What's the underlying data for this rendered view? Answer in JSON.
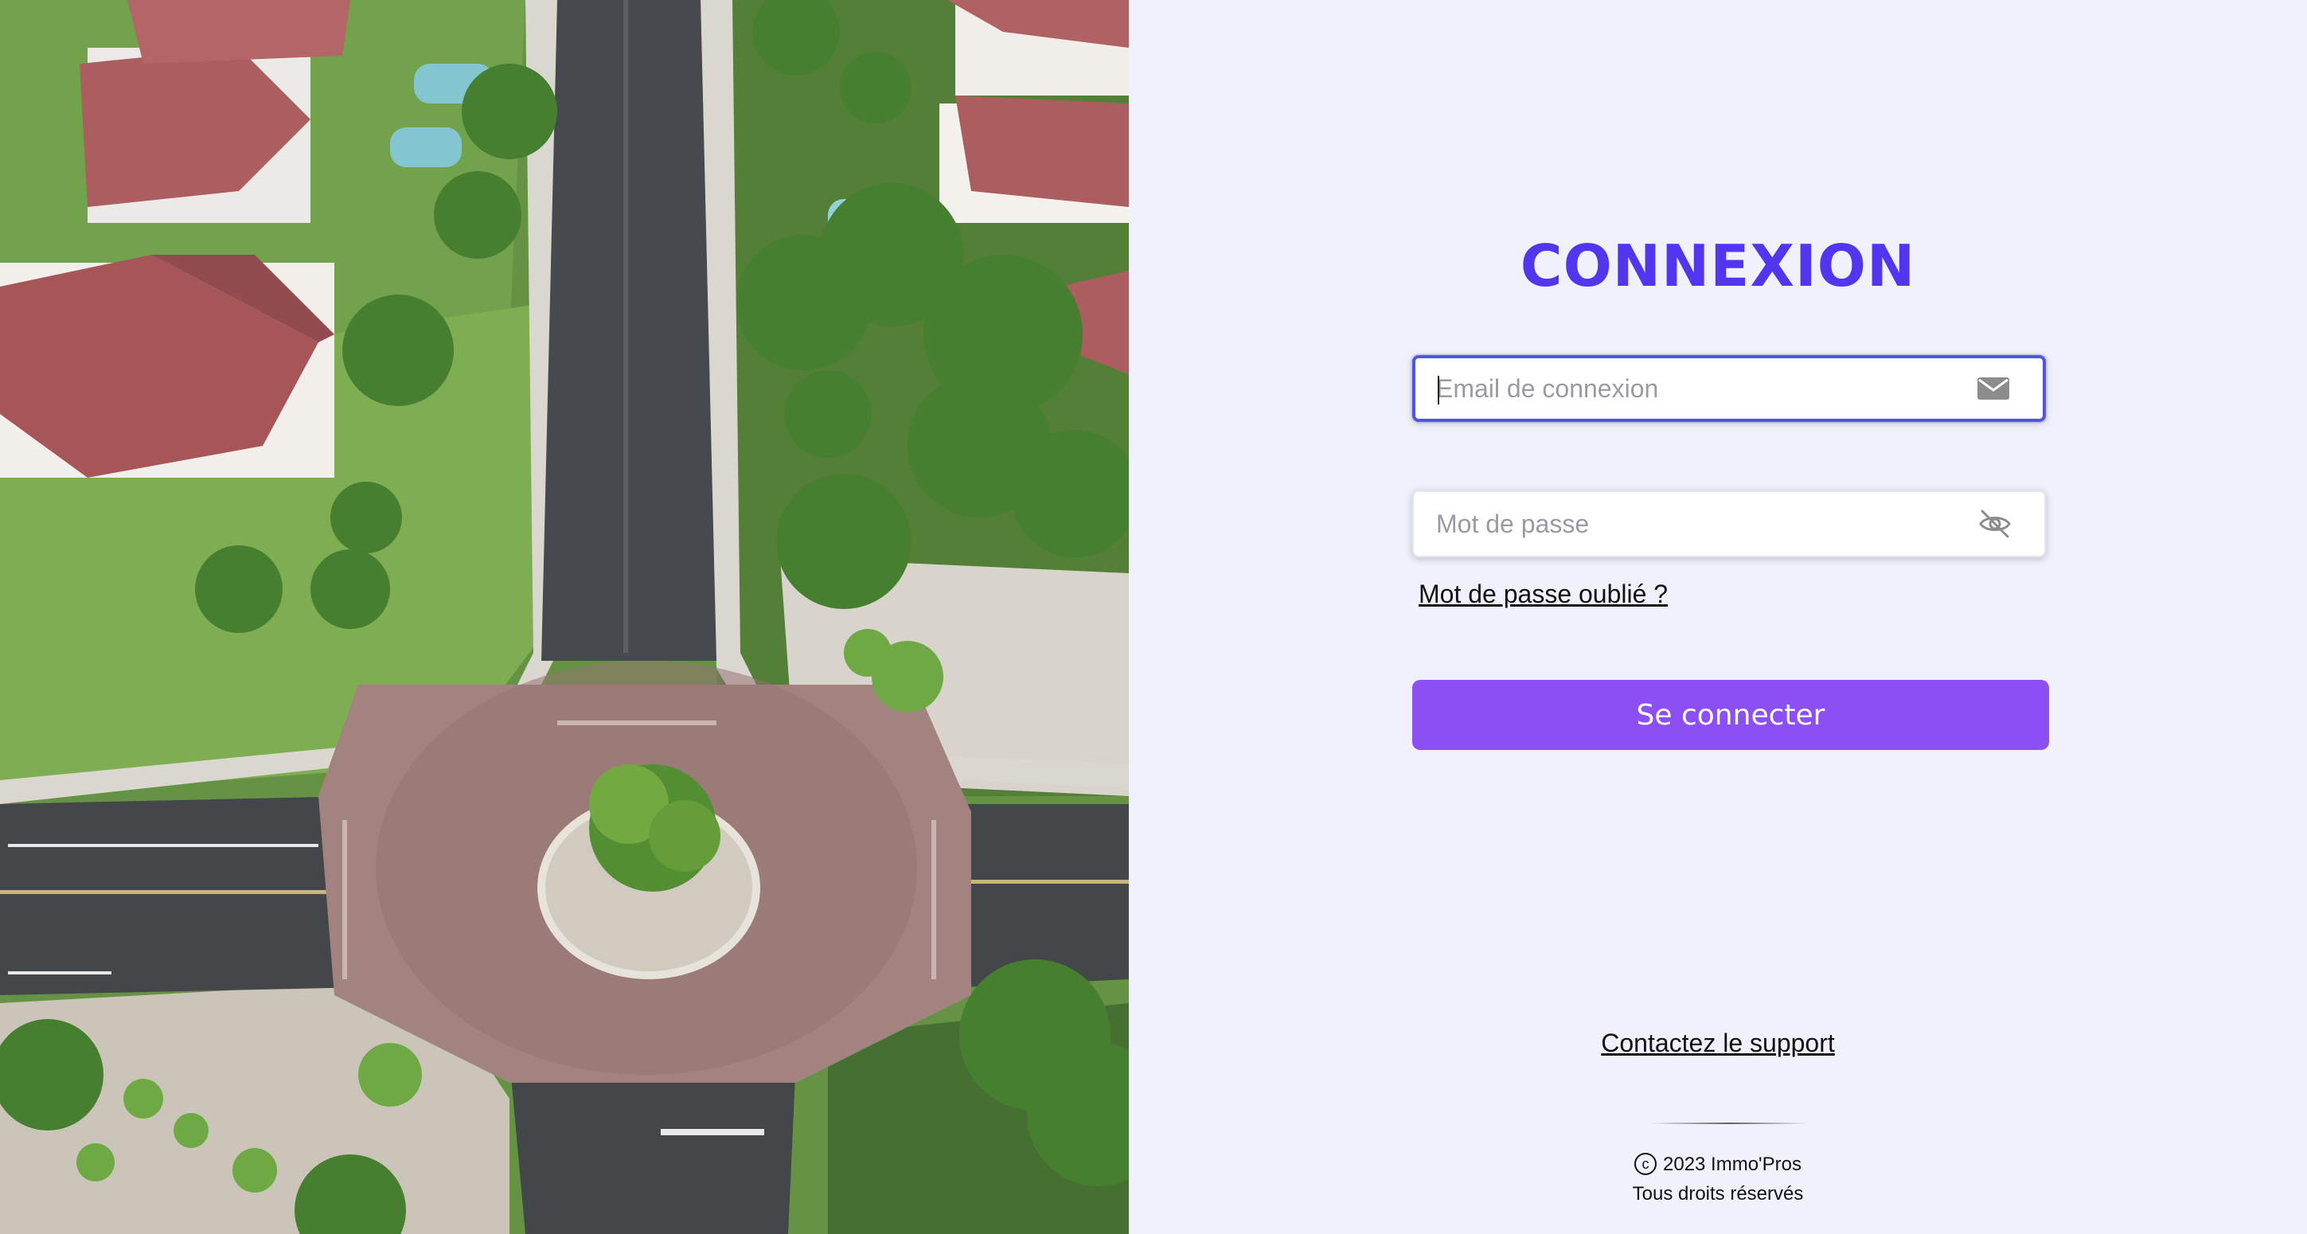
{
  "hero": {
    "icon": "aerial-neighborhood-roundabout-image"
  },
  "login": {
    "title": "CONNEXION",
    "email": {
      "placeholder": "Email de connexion",
      "value": "",
      "icon": "mail-icon"
    },
    "password": {
      "placeholder": "Mot de passe",
      "value": "",
      "icon": "eye-off-icon"
    },
    "forgot_label": "Mot de passe oublié ?",
    "submit_label": "Se connecter"
  },
  "footer": {
    "support_label": "Contactez le support",
    "copyright_symbol": "c",
    "copyright_line1": "2023 Immo'Pros",
    "copyright_line2": "Tous droits réservés"
  },
  "colors": {
    "title": "#5136ef",
    "focus_border": "#4f55e6",
    "button": "#8c4ff3",
    "panel_bg": "#f0f1fd"
  }
}
